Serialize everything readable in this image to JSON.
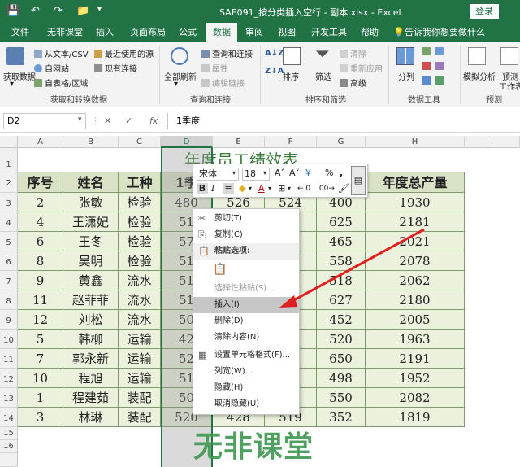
{
  "titlebar": {
    "title": "SAE091_按分类插入空行 - 副本.xlsx  -  Excel",
    "login": "登录",
    "qa_save": "💾",
    "qa_undo": "↶",
    "qa_redo": "↷",
    "qa_open": "📁"
  },
  "tabs": [
    {
      "label": "文件"
    },
    {
      "label": "无非课堂"
    },
    {
      "label": "插入"
    },
    {
      "label": "页面布局"
    },
    {
      "label": "公式"
    },
    {
      "label": "数据"
    },
    {
      "label": "审阅"
    },
    {
      "label": "视图"
    },
    {
      "label": "开发工具"
    },
    {
      "label": "帮助"
    },
    {
      "label": "告诉我你想要做什么"
    }
  ],
  "ribbon": {
    "get_data": "获取数据",
    "from_text": "从文本/CSV",
    "from_web": "自网站",
    "from_table": "自表格/区域",
    "recent_sources": "最近使用的源",
    "existing_conn": "现有连接",
    "refresh_all": "全部刷新",
    "queries_conn": "查询和连接",
    "properties": "属性",
    "edit_links": "编辑链接",
    "sort_az": "A↓Z",
    "sort_za": "Z↓A",
    "sort": "排序",
    "filter": "筛选",
    "clear": "清除",
    "reapply": "重新应用",
    "advanced": "高级",
    "split": "分列",
    "whatif": "模拟分析",
    "forecast_sheet": "预测",
    "forecast_sheet2": "工作表",
    "group_get": "获取和转换数据",
    "group_query": "查询和连接",
    "group_sort": "排序和筛选",
    "group_tools": "数据工具",
    "group_forecast": "预测"
  },
  "formula": {
    "namebox": "D2",
    "cancel": "✕",
    "enter": "✓",
    "fx": "fx",
    "content": "1季度"
  },
  "columns": [
    "A",
    "B",
    "C",
    "D",
    "E",
    "F",
    "G",
    "H",
    "I"
  ],
  "rows": [
    "1",
    "2",
    "3",
    "4",
    "5",
    "6",
    "7",
    "8",
    "9",
    "10",
    "11",
    "12",
    "13",
    "14",
    "15",
    "16"
  ],
  "sheet": {
    "title": "年度员工绩效表",
    "headers": [
      "序号",
      "姓名",
      "工种",
      "1季",
      "年度总产量"
    ],
    "data": [
      {
        "no": "2",
        "name": "张敏",
        "type": "检验",
        "d": "480",
        "e": "526",
        "f": "524",
        "g": "400",
        "total": "1930"
      },
      {
        "no": "4",
        "name": "王潇妃",
        "type": "检验",
        "d": "51",
        "e": "",
        "f": "",
        "g": "625",
        "total": "2181"
      },
      {
        "no": "6",
        "name": "王冬",
        "type": "检验",
        "d": "57",
        "e": "",
        "f": "",
        "g": "465",
        "total": "2021"
      },
      {
        "no": "8",
        "name": "吴明",
        "type": "检验",
        "d": "51",
        "e": "",
        "f": "",
        "g": "558",
        "total": "2078"
      },
      {
        "no": "9",
        "name": "黄鑫",
        "type": "流水",
        "d": "51",
        "e": "",
        "f": "",
        "g": "518",
        "total": "2062"
      },
      {
        "no": "11",
        "name": "赵菲菲",
        "type": "流水",
        "d": "51",
        "e": "",
        "f": "",
        "g": "627",
        "total": "2180"
      },
      {
        "no": "12",
        "name": "刘松",
        "type": "流水",
        "d": "50",
        "e": "",
        "f": "",
        "g": "452",
        "total": "2005"
      },
      {
        "no": "5",
        "name": "韩柳",
        "type": "运输",
        "d": "42",
        "e": "",
        "f": "",
        "g": "520",
        "total": "1963"
      },
      {
        "no": "7",
        "name": "郭永新",
        "type": "运输",
        "d": "52",
        "e": "",
        "f": "",
        "g": "650",
        "total": "2191"
      },
      {
        "no": "10",
        "name": "程旭",
        "type": "运输",
        "d": "51",
        "e": "",
        "f": "",
        "g": "498",
        "total": "1952"
      },
      {
        "no": "1",
        "name": "程建茹",
        "type": "装配",
        "d": "50",
        "e": "",
        "f": "",
        "g": "550",
        "total": "2082"
      },
      {
        "no": "3",
        "name": "林琳",
        "type": "装配",
        "d": "520",
        "e": "428",
        "f": "519",
        "g": "352",
        "total": "1819"
      }
    ]
  },
  "minitoolbar": {
    "font": "宋体",
    "size": "18",
    "grow": "A˄",
    "shrink": "A˅",
    "currency": "¥",
    "percent": "%",
    "comma": ",",
    "bold": "B",
    "italic": "I",
    "align": "≡",
    "fill": "◆",
    "fontcolor": "A",
    "borders": "⊞",
    "inc_dec": "←.0",
    "dec_dec": ".00→",
    "painter": "🖌"
  },
  "context_menu": [
    {
      "label": "剪切(T)",
      "icon": "✂",
      "dim": false,
      "hl": false,
      "sect": false
    },
    {
      "label": "复制(C)",
      "icon": "⎘",
      "dim": false,
      "hl": false,
      "sect": false
    },
    {
      "label": "粘贴选项:",
      "icon": "📋",
      "dim": false,
      "hl": false,
      "sect": true
    },
    {
      "label": "",
      "icon": "📋",
      "dim": false,
      "hl": false,
      "sect": false
    },
    {
      "label": "选择性粘贴(S)...",
      "icon": "",
      "dim": true,
      "hl": false,
      "sect": false
    },
    {
      "label": "插入(I)",
      "icon": "",
      "dim": false,
      "hl": true,
      "sect": false
    },
    {
      "label": "删除(D)",
      "icon": "",
      "dim": false,
      "hl": false,
      "sect": false
    },
    {
      "label": "清除内容(N)",
      "icon": "",
      "dim": false,
      "hl": false,
      "sect": false
    },
    {
      "label": "设置单元格格式(F)...",
      "icon": "▦",
      "dim": false,
      "hl": false,
      "sect": false
    },
    {
      "label": "列宽(W)...",
      "icon": "",
      "dim": false,
      "hl": false,
      "sect": false
    },
    {
      "label": "隐藏(H)",
      "icon": "",
      "dim": false,
      "hl": false,
      "sect": false
    },
    {
      "label": "取消隐藏(U)",
      "icon": "",
      "dim": false,
      "hl": false,
      "sect": false
    }
  ],
  "watermark": "无非课堂",
  "colors": {
    "excel_green": "#217346",
    "header_fill": "#d9e2c5",
    "body_fill": "#ebf1dd",
    "arrow": "#e02020"
  }
}
